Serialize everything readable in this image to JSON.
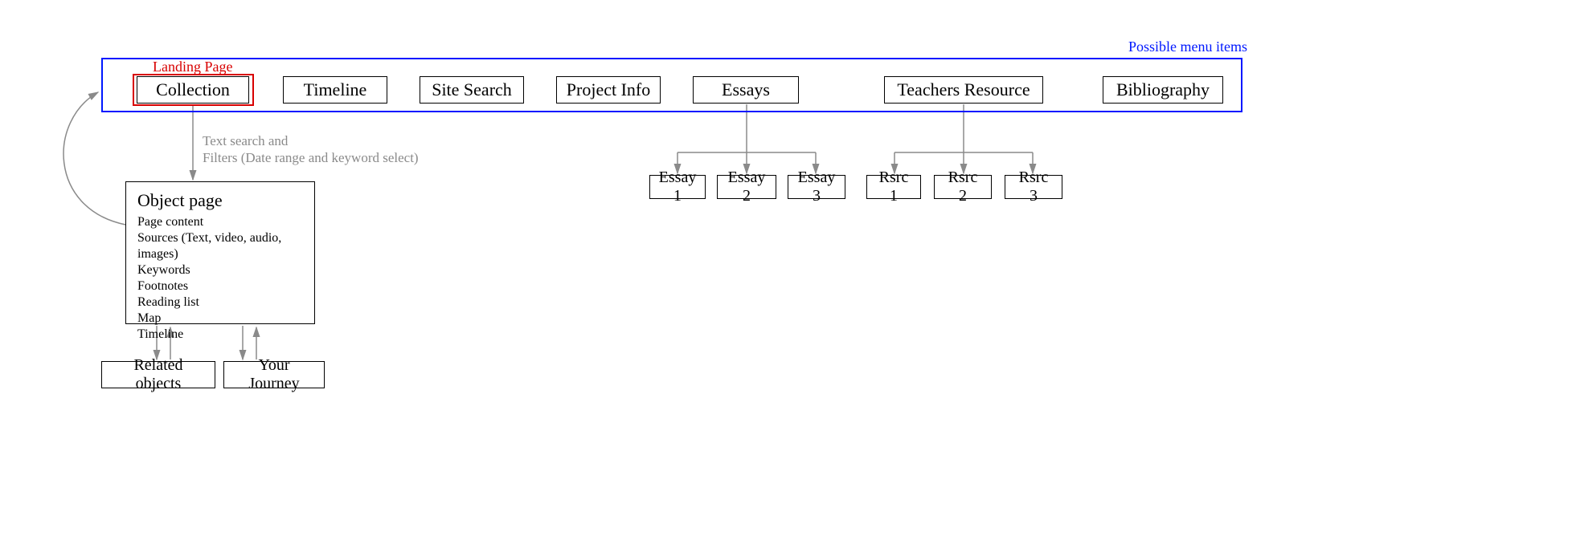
{
  "annotations": {
    "menu_group": "Possible menu items",
    "landing_page": "Landing Page",
    "filters_note_line1": "Text search and",
    "filters_note_line2": "Filters (Date range and keyword select)"
  },
  "menu": {
    "collection": "Collection",
    "timeline": "Timeline",
    "site_search": "Site Search",
    "project_info": "Project Info",
    "essays": "Essays",
    "teachers_resource": "Teachers Resource",
    "bibliography": "Bibliography"
  },
  "object_page": {
    "title": "Object page",
    "items": {
      "page_content": "Page content",
      "sources": "Sources (Text, video, audio, images)",
      "keywords": "Keywords",
      "footnotes": "Footnotes",
      "reading_list": "Reading list",
      "map": "Map",
      "timeline": "Timeline"
    }
  },
  "children": {
    "related_objects": "Related objects",
    "your_journey": "Your Journey",
    "essays": {
      "e1": "Essay 1",
      "e2": "Essay 2",
      "e3": "Essay 3"
    },
    "resources": {
      "r1": "Rsrc 1",
      "r2": "Rsrc 2",
      "r3": "Rsrc 3"
    }
  },
  "colors": {
    "frame_blue": "#0018ff",
    "highlight_red": "#d80000",
    "arrow_grey": "#8a8a8a",
    "text_black": "#000000"
  }
}
